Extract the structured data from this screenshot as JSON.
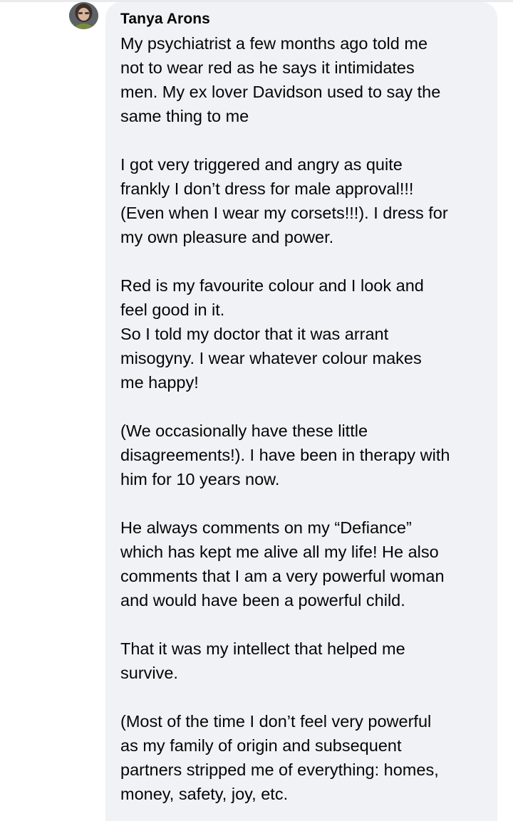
{
  "comment": {
    "author": "Tanya Arons",
    "paragraphs": [
      "My psychiatrist a few months ago told me\nnot to wear red as he says it intimidates\nmen.  My ex lover Davidson used to say the\nsame thing to me",
      "I got very triggered and angry as quite\nfrankly I don’t dress for male approval!!!\n(Even when I wear my corsets!!!).  I dress for\nmy own pleasure and power.",
      "Red is my favourite colour and I look and\nfeel good in it.\nSo I told my doctor that it was arrant\nmisogyny.  I wear whatever colour makes\nme happy!",
      "(We occasionally have these little\ndisagreements!). I have been in therapy with\nhim for 10 years now.",
      "He always comments on my “Defiance”\nwhich has kept me alive all my life!  He also\ncomments that I am a very powerful woman\nand would have been a powerful child.",
      "That it was my intellect that helped me\nsurvive.",
      "(Most of the time I don’t feel very powerful\nas my family of origin and subsequent\npartners stripped me of everything: homes,\nmoney, safety, joy, etc."
    ]
  },
  "avatar": {
    "icon": "user-avatar-photo"
  },
  "colors": {
    "bubble_background": "#f0f2f5",
    "text": "#050505",
    "page_background": "#ffffff"
  }
}
